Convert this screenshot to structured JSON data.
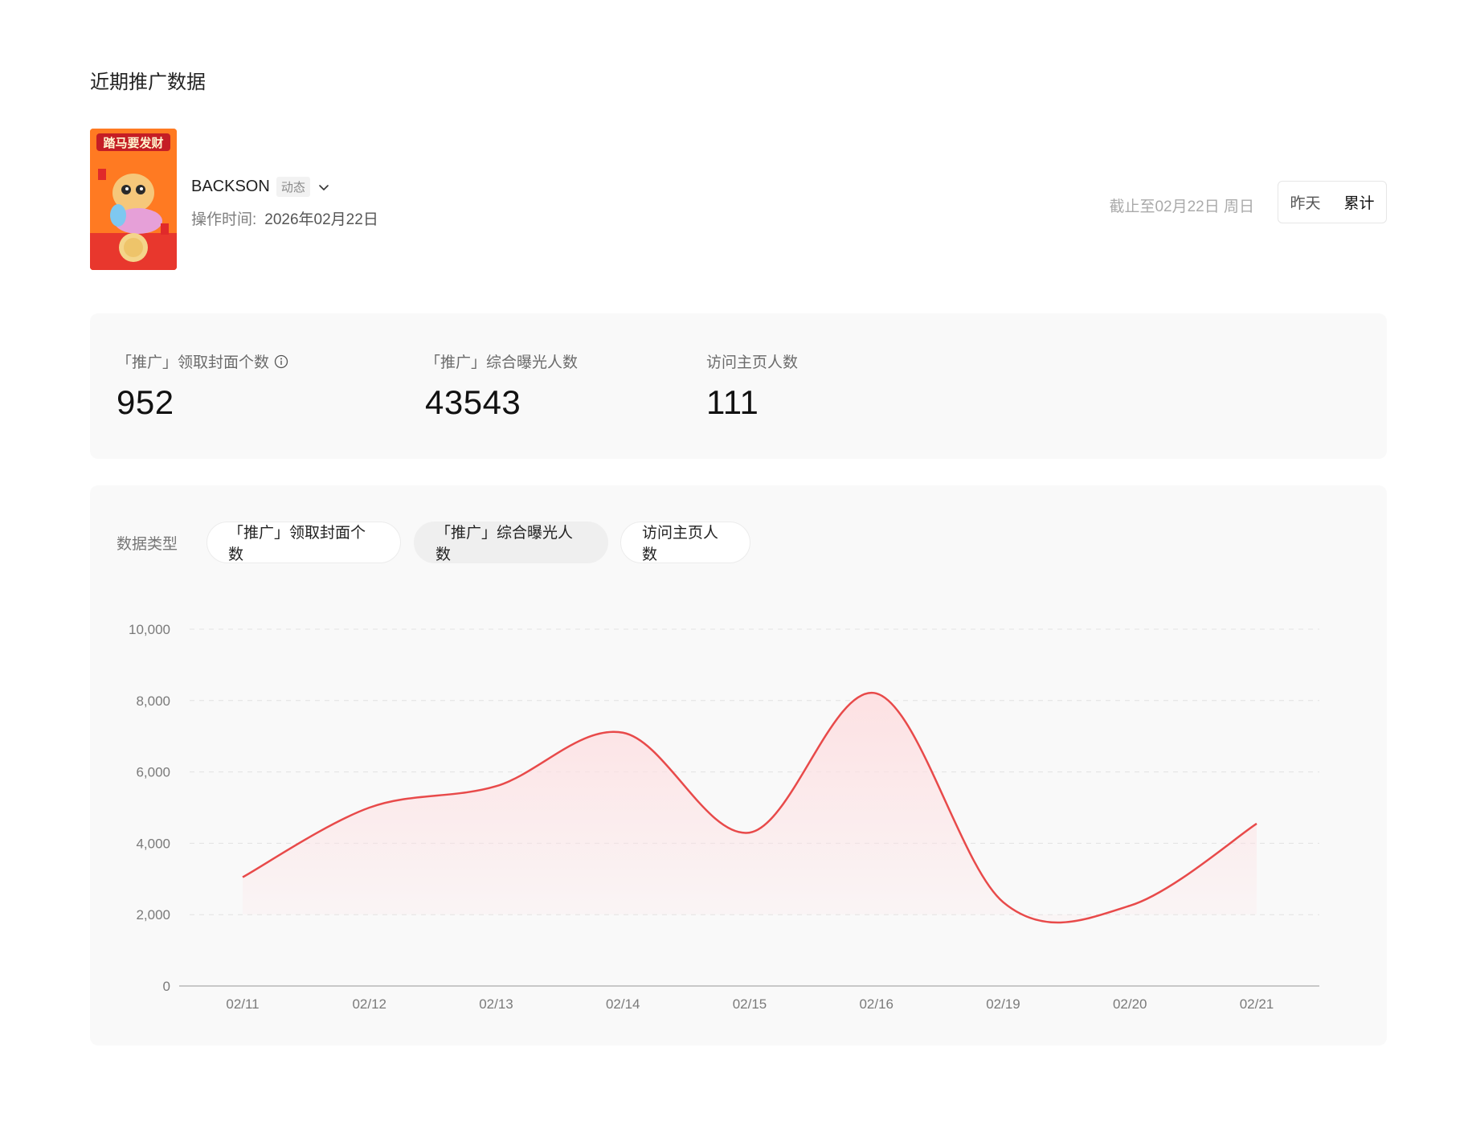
{
  "page": {
    "title": "近期推广数据"
  },
  "promo": {
    "cover": {
      "badge_text": "踏马要发财",
      "icon": "red-envelope-cover-image"
    },
    "account_name": "BACKSON",
    "account_tag": "动态",
    "op_time_label": "操作时间:",
    "op_time_value": "2026年02月22日",
    "date_info": "截止至02月22日 周日",
    "segment": {
      "options": [
        "昨天",
        "累计"
      ],
      "selected": "累计"
    }
  },
  "stats": [
    {
      "label": "「推广」领取封面个数",
      "value": "952",
      "has_info_icon": true
    },
    {
      "label": "「推广」综合曝光人数",
      "value": "43543",
      "has_info_icon": false
    },
    {
      "label": "访问主页人数",
      "value": "111",
      "has_info_icon": false
    }
  ],
  "chart_section": {
    "type_label": "数据类型",
    "tabs": [
      "「推广」领取封面个数",
      "「推广」综合曝光人数",
      "访问主页人数"
    ],
    "active_tab": "「推广」综合曝光人数"
  },
  "colors": {
    "line": "#e84a4a",
    "area_top": "#fde1e3",
    "grid": "#e2e2e2",
    "axis": "#c8c8c8"
  },
  "chart_data": {
    "type": "area",
    "title": "",
    "xlabel": "",
    "ylabel": "",
    "categories": [
      "02/11",
      "02/12",
      "02/13",
      "02/14",
      "02/15",
      "02/16",
      "02/19",
      "02/20",
      "02/21"
    ],
    "series": [
      {
        "values": [
          3050,
          5000,
          5600,
          7100,
          4300,
          8200,
          2350,
          2250,
          4550
        ]
      }
    ],
    "yticks": [
      0,
      2000,
      4000,
      6000,
      8000,
      10000
    ],
    "ytick_labels": [
      "0",
      "2,000",
      "4,000",
      "6,000",
      "8,000",
      "10,000"
    ],
    "ylim": [
      0,
      10000
    ],
    "grid": true,
    "legend": "none"
  }
}
